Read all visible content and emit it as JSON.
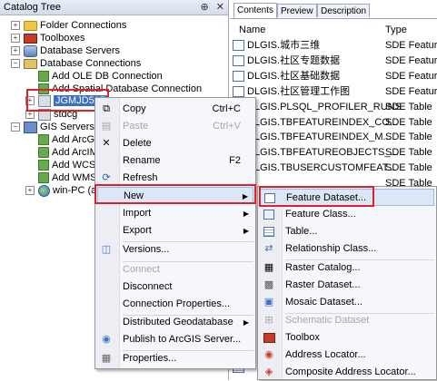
{
  "catalog": {
    "title": "Catalog Tree",
    "pin_glyph": "⊕",
    "close_glyph": "✕",
    "items": [
      {
        "label": "Folder Connections",
        "icon": "folder-icon"
      },
      {
        "label": "Toolboxes",
        "icon": "toolbox-icon"
      },
      {
        "label": "Database Servers",
        "icon": "database-server-icon"
      },
      {
        "label": "Database Connections",
        "icon": "database-connections-icon"
      },
      {
        "label": "Add OLE DB Connection",
        "icon": "add-connection-icon"
      },
      {
        "label": "Add Spatial Database Connection",
        "icon": "add-connection-icon"
      },
      {
        "label": "JGMJD515",
        "icon": "sde-connection-icon",
        "selected": true
      },
      {
        "label": "stdcg",
        "icon": "sde-connection-icon"
      },
      {
        "label": "GIS Servers",
        "icon": "gis-server-icon"
      },
      {
        "label": "Add ArcG",
        "icon": "add-server-icon"
      },
      {
        "label": "Add ArcIM",
        "icon": "add-server-icon"
      },
      {
        "label": "Add WCS",
        "icon": "add-server-icon"
      },
      {
        "label": "Add WMS",
        "icon": "add-server-icon"
      },
      {
        "label": "win-PC (a",
        "icon": "server-icon"
      }
    ]
  },
  "contents": {
    "tabs": [
      "Contents",
      "Preview",
      "Description"
    ],
    "active_tab": "Contents",
    "columns": {
      "name": "Name",
      "type": "Type"
    },
    "rows": [
      {
        "name": "DLGIS.城市三维",
        "type": "SDE Feature",
        "icon": "feature-dataset-icon"
      },
      {
        "name": "DLGIS.社区专题数据",
        "type": "SDE Feature",
        "icon": "feature-dataset-icon"
      },
      {
        "name": "DLGIS.社区基础数据",
        "type": "SDE Feature",
        "icon": "feature-dataset-icon"
      },
      {
        "name": "DLGIS.社区管理工作图",
        "type": "SDE Feature",
        "icon": "feature-dataset-icon"
      },
      {
        "name": "DLGIS.PLSQL_PROFILER_RUNS",
        "type": "SDE Table",
        "icon": "table-icon"
      },
      {
        "name": "DLGIS.TBFEATUREINDEX_CO...",
        "type": "SDE Table",
        "icon": "table-icon"
      },
      {
        "name": "DLGIS.TBFEATUREINDEX_M...",
        "type": "SDE Table",
        "icon": "table-icon"
      },
      {
        "name": "DLGIS.TBFEATUREOBJECTS_...",
        "type": "SDE Table",
        "icon": "table-icon"
      },
      {
        "name": "DLGIS.TBUSERCUSTOMFEAT...",
        "type": "SDE Table",
        "icon": "table-icon"
      },
      {
        "name": "",
        "type": "SDE Table",
        "icon": "table-icon"
      },
      {
        "name": "",
        "type": "SDE Table",
        "icon": "table-icon"
      },
      {
        "name": "",
        "type": "SDE Table",
        "icon": "table-icon"
      },
      {
        "name": "",
        "type": "SDE Table",
        "icon": "table-icon"
      },
      {
        "name": "",
        "type": "SDE Table",
        "icon": "table-icon"
      },
      {
        "name": "",
        "type": "SDE Table",
        "icon": "table-icon"
      },
      {
        "name": "",
        "type": "SDE Table",
        "icon": "table-icon"
      },
      {
        "name": "",
        "type": "SDE Table",
        "icon": "table-icon"
      },
      {
        "name": "",
        "type": "SDE Table",
        "icon": "table-icon"
      },
      {
        "name": "",
        "type": "SDE Table",
        "icon": "table-icon"
      },
      {
        "name": "",
        "type": "SDE Table",
        "icon": "table-icon"
      },
      {
        "name": "",
        "type": "SDE Table",
        "icon": "table-icon"
      },
      {
        "name": "",
        "type": "SDE Table",
        "icon": "table-icon"
      }
    ]
  },
  "context_menu": {
    "items": [
      {
        "label": "Copy",
        "accel": "Ctrl+C",
        "icon": "copy-icon",
        "enabled": true
      },
      {
        "label": "Paste",
        "accel": "Ctrl+V",
        "icon": "paste-icon",
        "enabled": false
      },
      {
        "label": "Delete",
        "accel": "",
        "icon": "delete-icon",
        "enabled": true
      },
      {
        "label": "Rename",
        "accel": "F2",
        "icon": "",
        "enabled": true
      },
      {
        "label": "Refresh",
        "accel": "",
        "icon": "refresh-icon",
        "enabled": true
      },
      {
        "label": "New",
        "accel": "",
        "icon": "",
        "enabled": true,
        "submenu": true
      },
      {
        "label": "Import",
        "accel": "",
        "icon": "",
        "enabled": true,
        "submenu": true
      },
      {
        "label": "Export",
        "accel": "",
        "icon": "",
        "enabled": true,
        "submenu": true
      },
      {
        "label": "Versions...",
        "accel": "",
        "icon": "versions-icon",
        "enabled": true
      },
      {
        "label": "Connect",
        "accel": "",
        "icon": "",
        "enabled": false
      },
      {
        "label": "Disconnect",
        "accel": "",
        "icon": "",
        "enabled": true
      },
      {
        "label": "Connection Properties...",
        "accel": "",
        "icon": "",
        "enabled": true
      },
      {
        "label": "Distributed Geodatabase",
        "accel": "",
        "icon": "",
        "enabled": true,
        "submenu": true
      },
      {
        "label": "Publish to ArcGIS Server...",
        "accel": "",
        "icon": "publish-icon",
        "enabled": true
      },
      {
        "label": "Properties...",
        "accel": "",
        "icon": "properties-icon",
        "enabled": true
      }
    ]
  },
  "submenu_new": {
    "items": [
      {
        "label": "Feature Dataset...",
        "icon": "feature-dataset-icon",
        "enabled": true
      },
      {
        "label": "Feature Class...",
        "icon": "feature-class-icon",
        "enabled": true
      },
      {
        "label": "Table...",
        "icon": "table-icon",
        "enabled": true
      },
      {
        "label": "Relationship Class...",
        "icon": "relationship-class-icon",
        "enabled": true
      },
      {
        "label": "Raster Catalog...",
        "icon": "raster-catalog-icon",
        "enabled": true
      },
      {
        "label": "Raster Dataset...",
        "icon": "raster-dataset-icon",
        "enabled": true
      },
      {
        "label": "Mosaic Dataset...",
        "icon": "mosaic-dataset-icon",
        "enabled": true
      },
      {
        "label": "Schematic Dataset",
        "icon": "schematic-dataset-icon",
        "enabled": false
      },
      {
        "label": "Toolbox",
        "icon": "toolbox-icon",
        "enabled": true
      },
      {
        "label": "Address Locator...",
        "icon": "address-locator-icon",
        "enabled": true
      },
      {
        "label": "Composite Address Locator...",
        "icon": "composite-address-locator-icon",
        "enabled": true
      }
    ]
  },
  "colors": {
    "highlight_red": "#e0212b",
    "selection_blue": "#3a6fc4",
    "menu_hover": "#dbe6f7"
  }
}
